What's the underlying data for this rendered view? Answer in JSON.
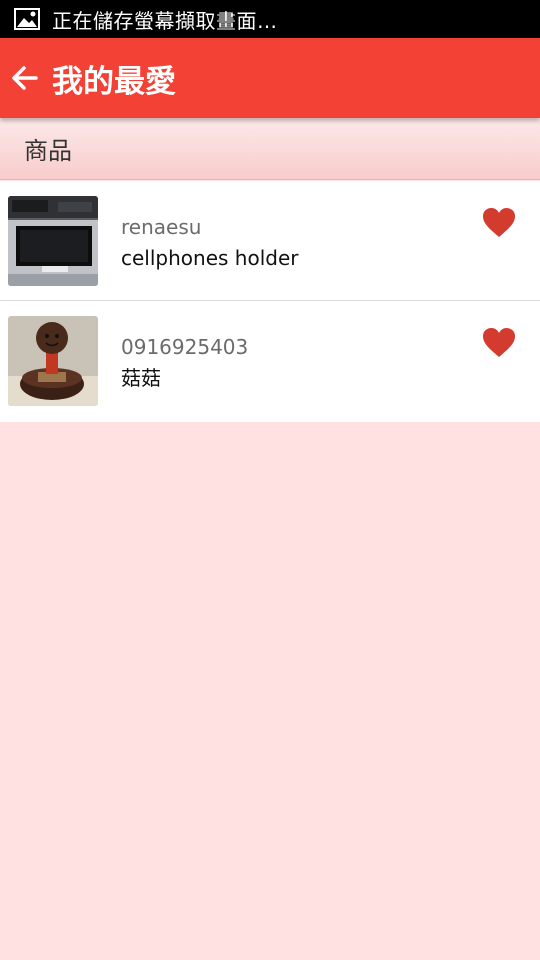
{
  "status_bar": {
    "notification_text": "正在儲存螢幕擷取畫面…",
    "icon": "image-icon"
  },
  "app_bar": {
    "back_icon": "arrow-left-icon",
    "title": "我的最愛",
    "background_color": "#f44136"
  },
  "section": {
    "title": "商品"
  },
  "favorites": [
    {
      "seller": "renaesu",
      "name": "cellphones holder",
      "thumbnail": "phone-holder-photo",
      "favorite_icon": "heart-icon"
    },
    {
      "seller": "0916925403",
      "name": "菇菇",
      "thumbnail": "mushroom-figure-photo",
      "favorite_icon": "heart-icon"
    }
  ],
  "colors": {
    "accent": "#f44136",
    "heart": "#d43b2f",
    "page_background": "#ffe1e1"
  }
}
